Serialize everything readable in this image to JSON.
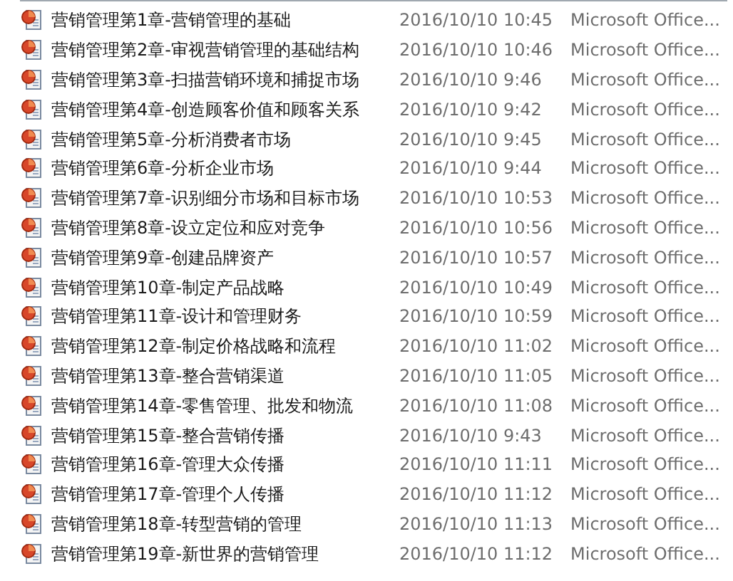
{
  "files": [
    {
      "name": "营销管理第1章-营销管理的基础",
      "modified": "2016/10/10 10:45",
      "type": "Microsoft Office..."
    },
    {
      "name": "营销管理第2章-审视营销管理的基础结构",
      "modified": "2016/10/10 10:46",
      "type": "Microsoft Office..."
    },
    {
      "name": "营销管理第3章-扫描营销环境和捕捉市场",
      "modified": "2016/10/10 9:46",
      "type": "Microsoft Office..."
    },
    {
      "name": "营销管理第4章-创造顾客价值和顾客关系",
      "modified": "2016/10/10 9:42",
      "type": "Microsoft Office..."
    },
    {
      "name": "营销管理第5章-分析消费者市场",
      "modified": "2016/10/10 9:45",
      "type": "Microsoft Office..."
    },
    {
      "name": "营销管理第6章-分析企业市场",
      "modified": "2016/10/10 9:44",
      "type": "Microsoft Office..."
    },
    {
      "name": "营销管理第7章-识别细分市场和目标市场",
      "modified": "2016/10/10 10:53",
      "type": "Microsoft Office..."
    },
    {
      "name": "营销管理第8章-设立定位和应对竞争",
      "modified": "2016/10/10 10:56",
      "type": "Microsoft Office..."
    },
    {
      "name": "营销管理第9章-创建品牌资产",
      "modified": "2016/10/10 10:57",
      "type": "Microsoft Office..."
    },
    {
      "name": "营销管理第10章-制定产品战略",
      "modified": "2016/10/10 10:49",
      "type": "Microsoft Office..."
    },
    {
      "name": "营销管理第11章-设计和管理财务",
      "modified": "2016/10/10 10:59",
      "type": "Microsoft Office..."
    },
    {
      "name": "营销管理第12章-制定价格战略和流程",
      "modified": "2016/10/10 11:02",
      "type": "Microsoft Office..."
    },
    {
      "name": "营销管理第13章-整合营销渠道",
      "modified": "2016/10/10 11:05",
      "type": "Microsoft Office..."
    },
    {
      "name": "营销管理第14章-零售管理、批发和物流",
      "modified": "2016/10/10 11:08",
      "type": "Microsoft Office..."
    },
    {
      "name": "营销管理第15章-整合营销传播",
      "modified": "2016/10/10 9:43",
      "type": "Microsoft Office..."
    },
    {
      "name": "营销管理第16章-管理大众传播",
      "modified": "2016/10/10 11:11",
      "type": "Microsoft Office..."
    },
    {
      "name": "营销管理第17章-管理个人传播",
      "modified": "2016/10/10 11:12",
      "type": "Microsoft Office..."
    },
    {
      "name": "营销管理第18章-转型营销的管理",
      "modified": "2016/10/10 11:13",
      "type": "Microsoft Office..."
    },
    {
      "name": "营销管理第19章-新世界的营销管理",
      "modified": "2016/10/10 11:12",
      "type": "Microsoft Office..."
    }
  ]
}
